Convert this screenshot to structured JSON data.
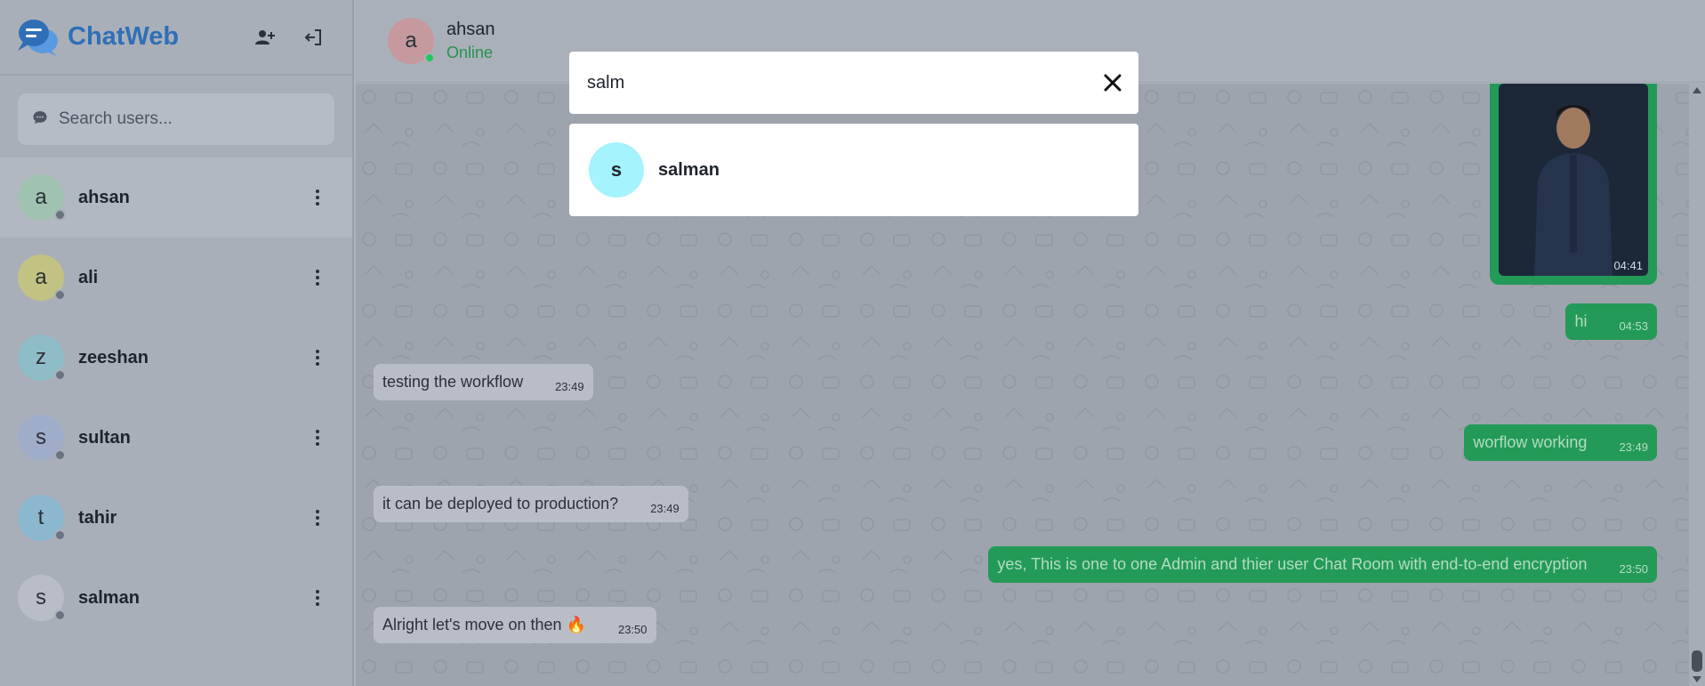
{
  "app": {
    "name": "ChatWeb"
  },
  "sidebar": {
    "search_placeholder": "Search users...",
    "users": [
      {
        "initial": "a",
        "name": "ahsan",
        "color": "#9fc3b0",
        "active": true
      },
      {
        "initial": "a",
        "name": "ali",
        "color": "#c2c283"
      },
      {
        "initial": "z",
        "name": "zeeshan",
        "color": "#8fbdc7"
      },
      {
        "initial": "s",
        "name": "sultan",
        "color": "#9fadc9"
      },
      {
        "initial": "t",
        "name": "tahir",
        "color": "#8bb8cf"
      },
      {
        "initial": "s",
        "name": "salman",
        "color": "#b9bec6"
      }
    ]
  },
  "header": {
    "initial": "a",
    "name": "ahsan",
    "status": "Online"
  },
  "messages": [
    {
      "type": "photo",
      "time": "04:41"
    },
    {
      "type": "out",
      "text": "hi",
      "time": "04:53"
    },
    {
      "type": "in",
      "text": "testing the workflow",
      "time": "23:49"
    },
    {
      "type": "out",
      "text": "worflow working",
      "time": "23:49"
    },
    {
      "type": "in",
      "text": "it can be deployed to production?",
      "time": "23:49"
    },
    {
      "type": "out",
      "text": "yes, This is one to one Admin and thier user Chat Room with end-to-end encryption",
      "time": "23:50"
    },
    {
      "type": "in",
      "text": "Alright let's move on then 🔥",
      "time": "23:50"
    }
  ],
  "search_overlay": {
    "query": "salm",
    "results": [
      {
        "initial": "s",
        "name": "salman"
      }
    ]
  },
  "colors": {
    "brand": "#2f6fb8",
    "outgoing": "#239a57",
    "online": "#22c55e"
  }
}
